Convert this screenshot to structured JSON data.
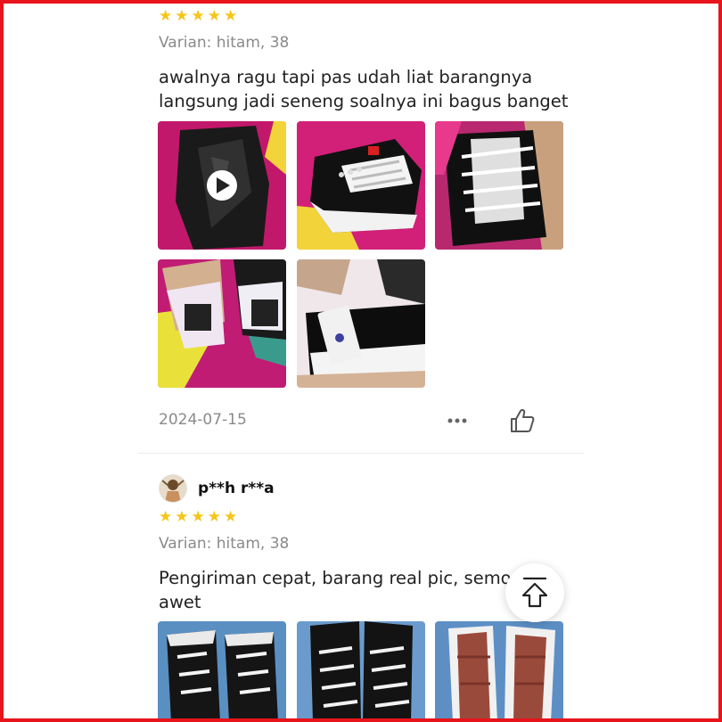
{
  "review1": {
    "rating": 5,
    "variant": "Varian: hitam, 38",
    "text_line1": "awalnya ragu tapi pas udah liat barangnya",
    "text_line2": "langsung jadi seneng soalnya ini bagus banget",
    "photos": [
      "video-thumbnail",
      "shoe-photo",
      "shoe-laces-photo",
      "shoe-heels-photo",
      "shoe-tag-photo"
    ],
    "date": "2024-07-15",
    "more_icon": "more-icon",
    "like_icon": "thumbs-up-icon"
  },
  "review2": {
    "username": "p**h r**a",
    "rating": 5,
    "variant": "Varian: hitam, 38",
    "text_line1": "Pengiriman cepat, barang real pic, semog",
    "text_line2": "awet",
    "photos": [
      "shoe-top-photo",
      "shoe-pair-photo",
      "shoe-sole-photo"
    ]
  },
  "scroll_top_icon": "scroll-to-top-icon",
  "colors": {
    "star": "#f5c518",
    "muted": "#8a8a8a",
    "frame": "#e8141b"
  }
}
